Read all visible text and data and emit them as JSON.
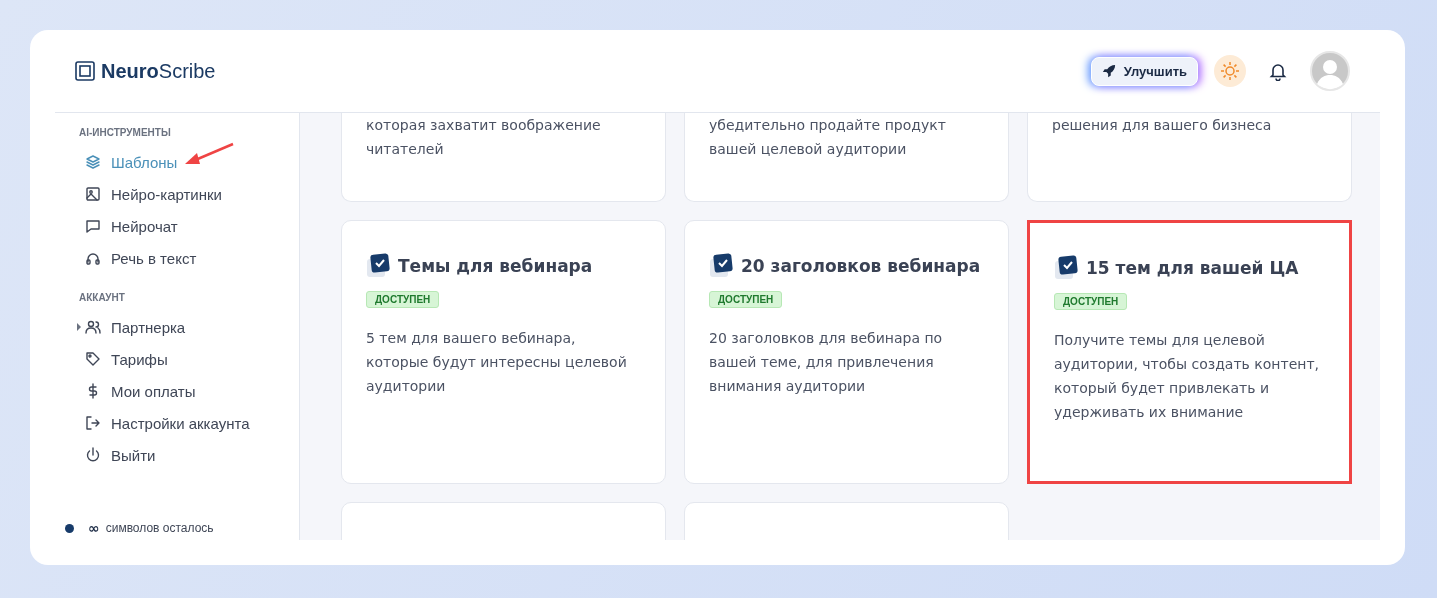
{
  "logo": {
    "bold": "Neuro",
    "light": "Scribe"
  },
  "header": {
    "upgrade_button": "Улучшить"
  },
  "sidebar": {
    "sections": [
      {
        "title": "AI-ИНСТРУМЕНТЫ",
        "items": [
          {
            "label": "Шаблоны",
            "selected": true,
            "pointed": true
          },
          {
            "label": "Нейро-картинки",
            "selected": false,
            "pointed": false
          },
          {
            "label": "Нейрочат",
            "selected": false,
            "pointed": false
          },
          {
            "label": "Речь в текст",
            "selected": false,
            "pointed": false
          }
        ]
      },
      {
        "title": "АККАУНТ",
        "items": [
          {
            "label": "Партнерка",
            "selected": false,
            "pointed": false,
            "expandable": true
          },
          {
            "label": "Тарифы",
            "selected": false,
            "pointed": false
          },
          {
            "label": "Мои оплаты",
            "selected": false,
            "pointed": false
          },
          {
            "label": "Настройки аккаунта",
            "selected": false,
            "pointed": false
          },
          {
            "label": "Выйти",
            "selected": false,
            "pointed": false
          }
        ]
      }
    ],
    "balance": {
      "amount": "∞",
      "label": "символов осталось"
    }
  },
  "top_cards": [
    {
      "lines": [
        "которая захватит воображение",
        "читателей"
      ]
    },
    {
      "lines": [
        "убедительно продайте продукт",
        "вашей целевой аудитории"
      ]
    },
    {
      "lines": [
        "решения для вашего бизнеса"
      ]
    }
  ],
  "cards": [
    {
      "title": "Темы для вебинара",
      "badge": "ДОСТУПЕН",
      "description": "5 тем для вашего вебинара, которые будут интересны целевой аудитории",
      "highlighted": false
    },
    {
      "title": "20 заголовков вебинара",
      "badge": "ДОСТУПЕН",
      "description": "20 заголовков для вебинара по вашей теме, для привлечения внимания аудитории",
      "highlighted": false
    },
    {
      "title": "15 тем для вашей ЦА",
      "badge": "ДОСТУПЕН",
      "description": "Получите темы для целевой аудитории, чтобы создать контент, который будет привлекать и удерживать их внимание",
      "highlighted": true
    }
  ]
}
